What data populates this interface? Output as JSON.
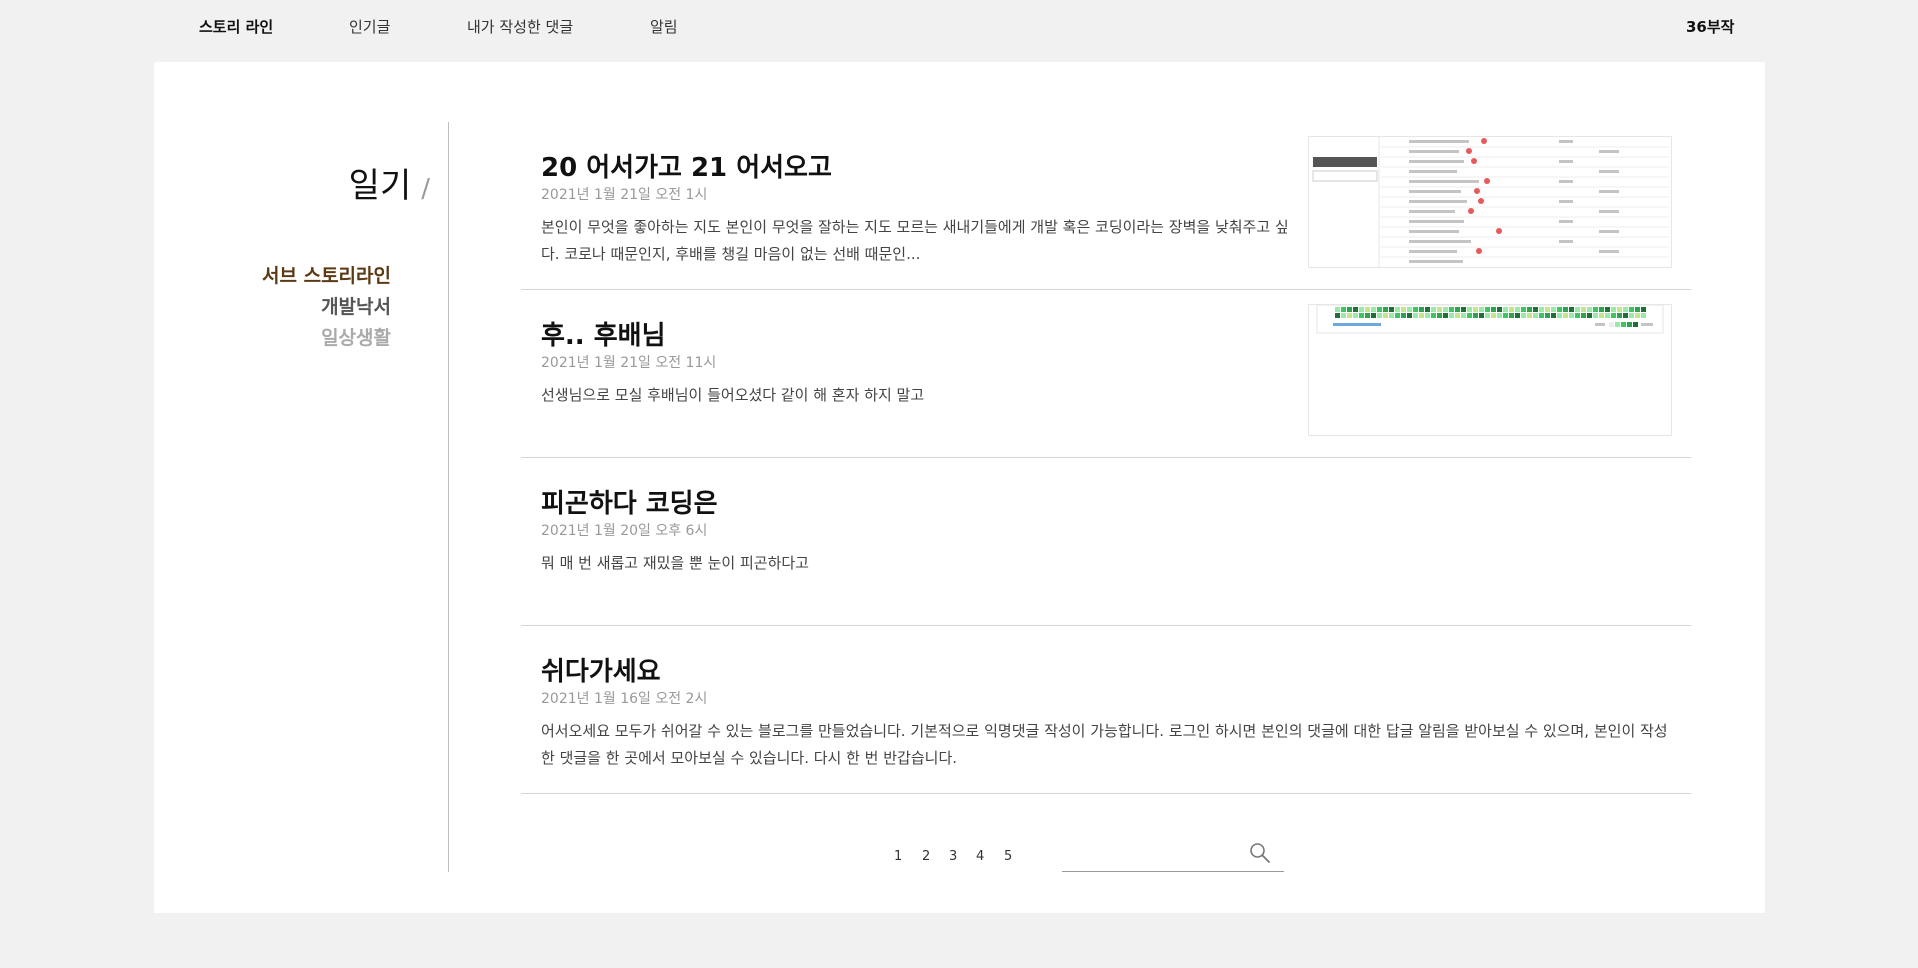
{
  "nav": {
    "brand": "스토리 라인",
    "items": [
      "인기글",
      "내가 작성한 댓글",
      "알림"
    ],
    "user": "36부작"
  },
  "sidebar": {
    "category_title": "일기",
    "slash": "/",
    "subcategories": [
      "서브 스토리라인",
      "개발낙서",
      "일상생활"
    ]
  },
  "posts": [
    {
      "title": "20 어서가고 21 어서오고",
      "date": "2021년 1월 21일 오전 1시",
      "excerpt": "본인이 무엇을 좋아하는 지도 본인이 무엇을 잘하는 지도 모르는 새내기들에게 개발 혹은 코딩이라는 장벽을 낮춰주고 싶다. 코로나 때문인지, 후배를 챙길 마음이 없는 선배 때문인...",
      "has_thumbnail": true
    },
    {
      "title": "후.. 후배님",
      "date": "2021년 1월 21일 오전 11시",
      "excerpt": "선생님으로 모실 후배님이 들어오셨다 같이 해 혼자 하지 말고",
      "has_thumbnail": true
    },
    {
      "title": "피곤하다 코딩은",
      "date": "2021년 1월 20일 오후 6시",
      "excerpt": "뭐 매 번 새롭고 재밌을 뿐 눈이 피곤하다고",
      "has_thumbnail": false
    },
    {
      "title": "쉬다가세요",
      "date": "2021년 1월 16일 오전 2시",
      "excerpt": "어서오세요 모두가 쉬어갈 수 있는 블로그를 만들었습니다. 기본적으로 익명댓글 작성이 가능합니다. 로그인 하시면 본인의 댓글에 대한 답글 알림을 받아보실 수 있으며, 본인이 작성한 댓글을 한 곳에서 모아보실 수 있습니다. 다시 한 번 반갑습니다.",
      "has_thumbnail": false
    }
  ],
  "pagination": [
    "1",
    "2",
    "3",
    "4",
    "5"
  ],
  "search": {
    "placeholder": "",
    "value": ""
  },
  "icons": {
    "search": "search-icon"
  },
  "colors": {
    "active_subcategory": "#5b3a13",
    "background": "#f1f1f1",
    "panel": "#ffffff"
  }
}
